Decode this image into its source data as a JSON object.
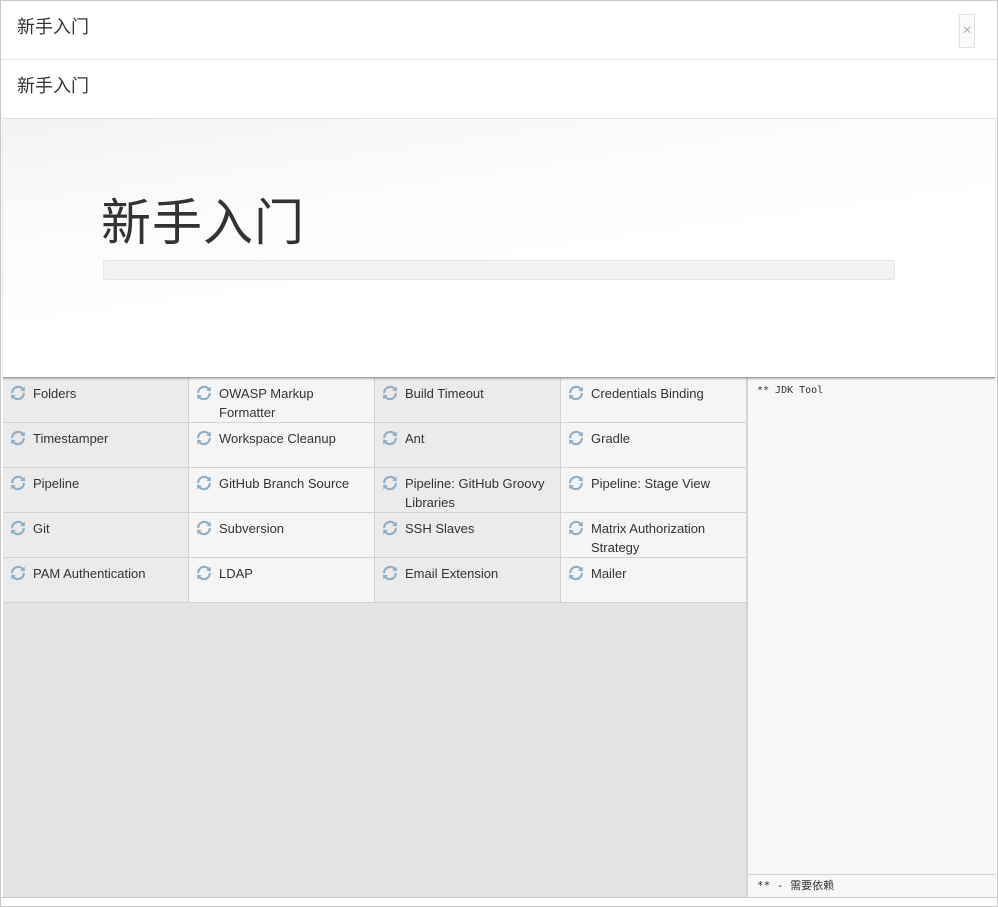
{
  "dialog": {
    "title": "新手入门",
    "close_label": "×"
  },
  "breadcrumb": "新手入门",
  "hero": {
    "title": "新手入门",
    "progress": 0
  },
  "plugins": [
    {
      "name": "Folders"
    },
    {
      "name": "OWASP Markup Formatter"
    },
    {
      "name": "Build Timeout"
    },
    {
      "name": "Credentials Binding"
    },
    {
      "name": "Timestamper"
    },
    {
      "name": "Workspace Cleanup"
    },
    {
      "name": "Ant"
    },
    {
      "name": "Gradle"
    },
    {
      "name": "Pipeline"
    },
    {
      "name": "GitHub Branch Source"
    },
    {
      "name": "Pipeline: GitHub Groovy Libraries"
    },
    {
      "name": "Pipeline: Stage View"
    },
    {
      "name": "Git"
    },
    {
      "name": "Subversion"
    },
    {
      "name": "SSH Slaves"
    },
    {
      "name": "Matrix Authorization Strategy"
    },
    {
      "name": "PAM Authentication"
    },
    {
      "name": "LDAP"
    },
    {
      "name": "Email Extension"
    },
    {
      "name": "Mailer"
    }
  ],
  "plugin_status_icon": "refresh-icon",
  "log": {
    "text": "** JDK Tool",
    "footer": "** - 需要依赖"
  },
  "colors": {
    "icon": "#8faec6",
    "panel_bg": "#e3e3e3",
    "cell_alt": "#f5f5f5",
    "cell_base": "#ebebeb"
  }
}
